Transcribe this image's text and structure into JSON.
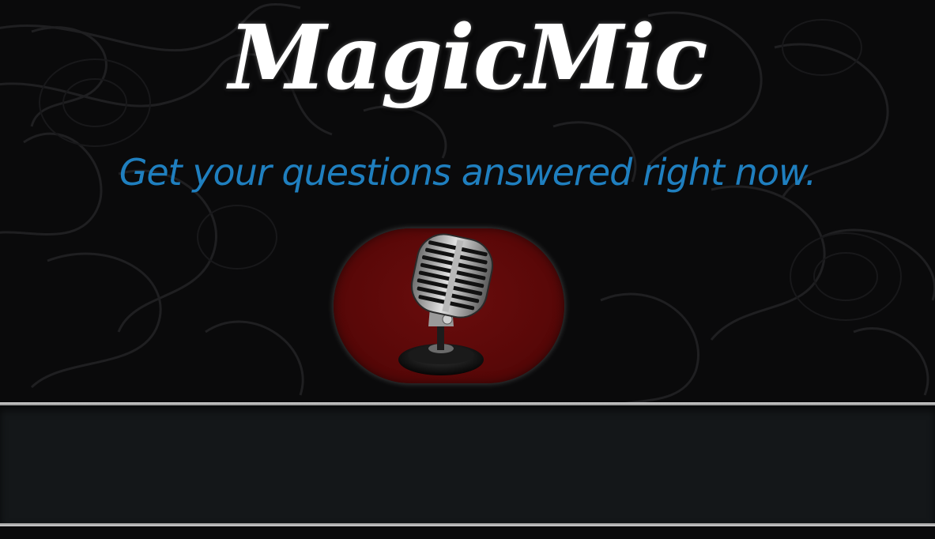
{
  "app": {
    "title": "MagicMic",
    "tagline": "Get your questions answered right now."
  },
  "mic": {
    "icon": "microphone-icon",
    "accent_color": "#5a0808"
  },
  "response": {
    "text": ""
  },
  "colors": {
    "background": "#0a0a0b",
    "title": "#ffffff",
    "tagline": "#1f7fbf",
    "panel": "#141719"
  }
}
